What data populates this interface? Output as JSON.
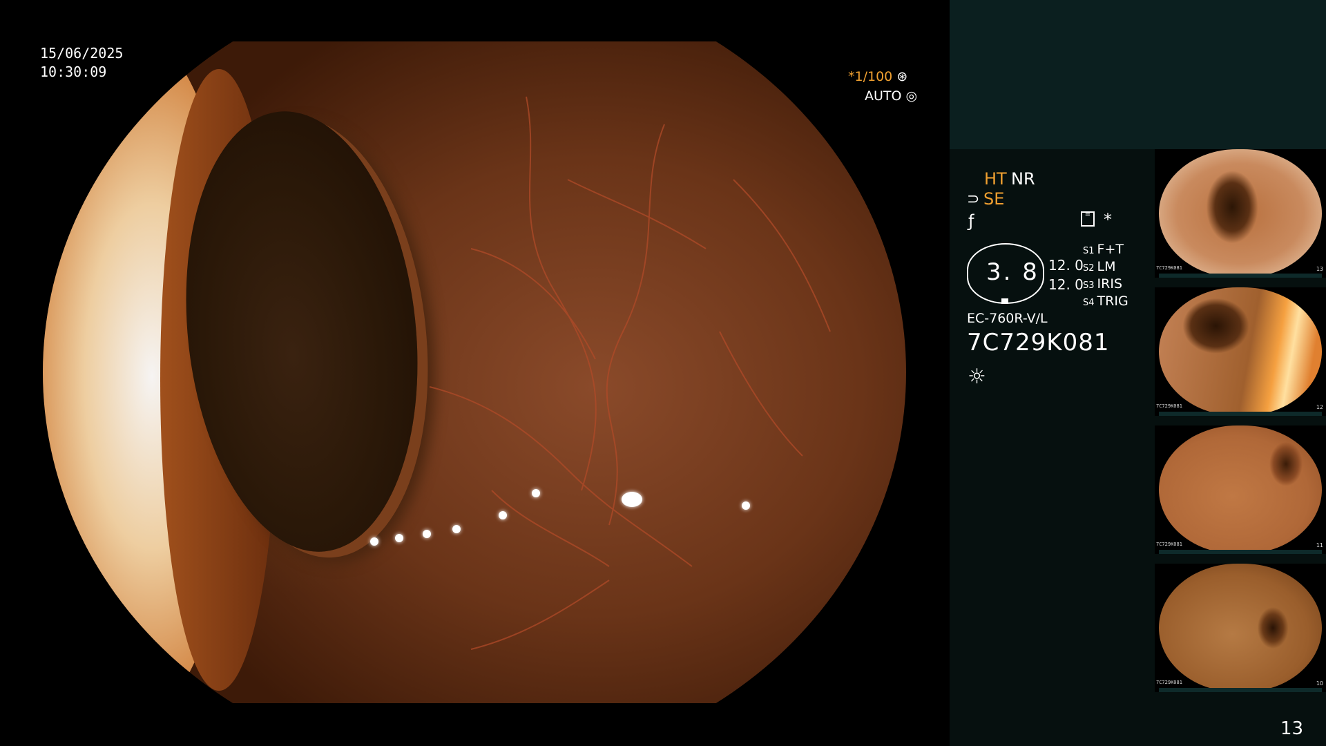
{
  "overlay": {
    "date": "15/06/2025",
    "time": "10:30:09",
    "shutter": "*1/100",
    "shutter_icon": "aperture-icon",
    "iris_mode": "AUTO",
    "iris_icon": "iris-icon"
  },
  "settings": {
    "ht": "HT",
    "nr": "NR",
    "se": "SE",
    "star": "*",
    "enhance_icon": "enhance-icon",
    "structure_icon": "structure-icon",
    "grid_icon": "image-mode-icon"
  },
  "gauge": {
    "value": "3. 8",
    "left_value": "12. 0",
    "left_value2": "12. 0"
  },
  "switches": [
    {
      "key": "S1",
      "value": "F+T"
    },
    {
      "key": "S2",
      "value": "LM"
    },
    {
      "key": "S3",
      "value": "IRIS"
    },
    {
      "key": "S4",
      "value": "TRIG"
    }
  ],
  "scope": {
    "model": "EC-760R-V/L",
    "serial": "7C729K081",
    "light_icon": "light-sun-icon"
  },
  "thumbnails": [
    {
      "label": "7C729K081",
      "number": "13"
    },
    {
      "label": "7C729K081",
      "number": "12"
    },
    {
      "label": "7C729K081",
      "number": "11"
    },
    {
      "label": "7C729K081",
      "number": "10"
    }
  ],
  "page_number": "13",
  "colors": {
    "accent": "#f0a030",
    "panel_bg": "#06100f",
    "panel_top": "#0b1f1f"
  }
}
